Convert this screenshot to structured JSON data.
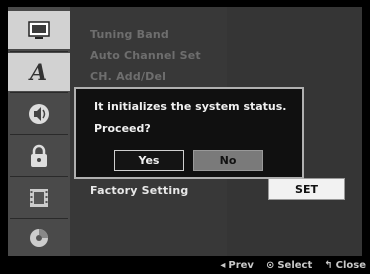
{
  "menu": {
    "items": [
      {
        "label": "Tuning Band"
      },
      {
        "label": "Auto Channel Set"
      },
      {
        "label": "CH. Add/Del"
      },
      {
        "label": "Factory Setting"
      }
    ],
    "set_label": "SET"
  },
  "dialog": {
    "line1": "It initializes the system status.",
    "line2": "Proceed?",
    "yes_label": "Yes",
    "no_label": "No",
    "selected": "No"
  },
  "hints": {
    "prev": "Prev",
    "select": "Select",
    "close": "Close"
  },
  "icons": [
    "tv-icon",
    "language-icon",
    "audio-icon",
    "lock-icon",
    "film-icon",
    "disc-icon"
  ],
  "colors": {
    "background": "#000000",
    "rail": "#4a4a4a",
    "rail_active": "#d2d2d2",
    "panel": "#383838",
    "dialog_border": "#b0b0b0",
    "selected_button": "#7a7a7a"
  }
}
